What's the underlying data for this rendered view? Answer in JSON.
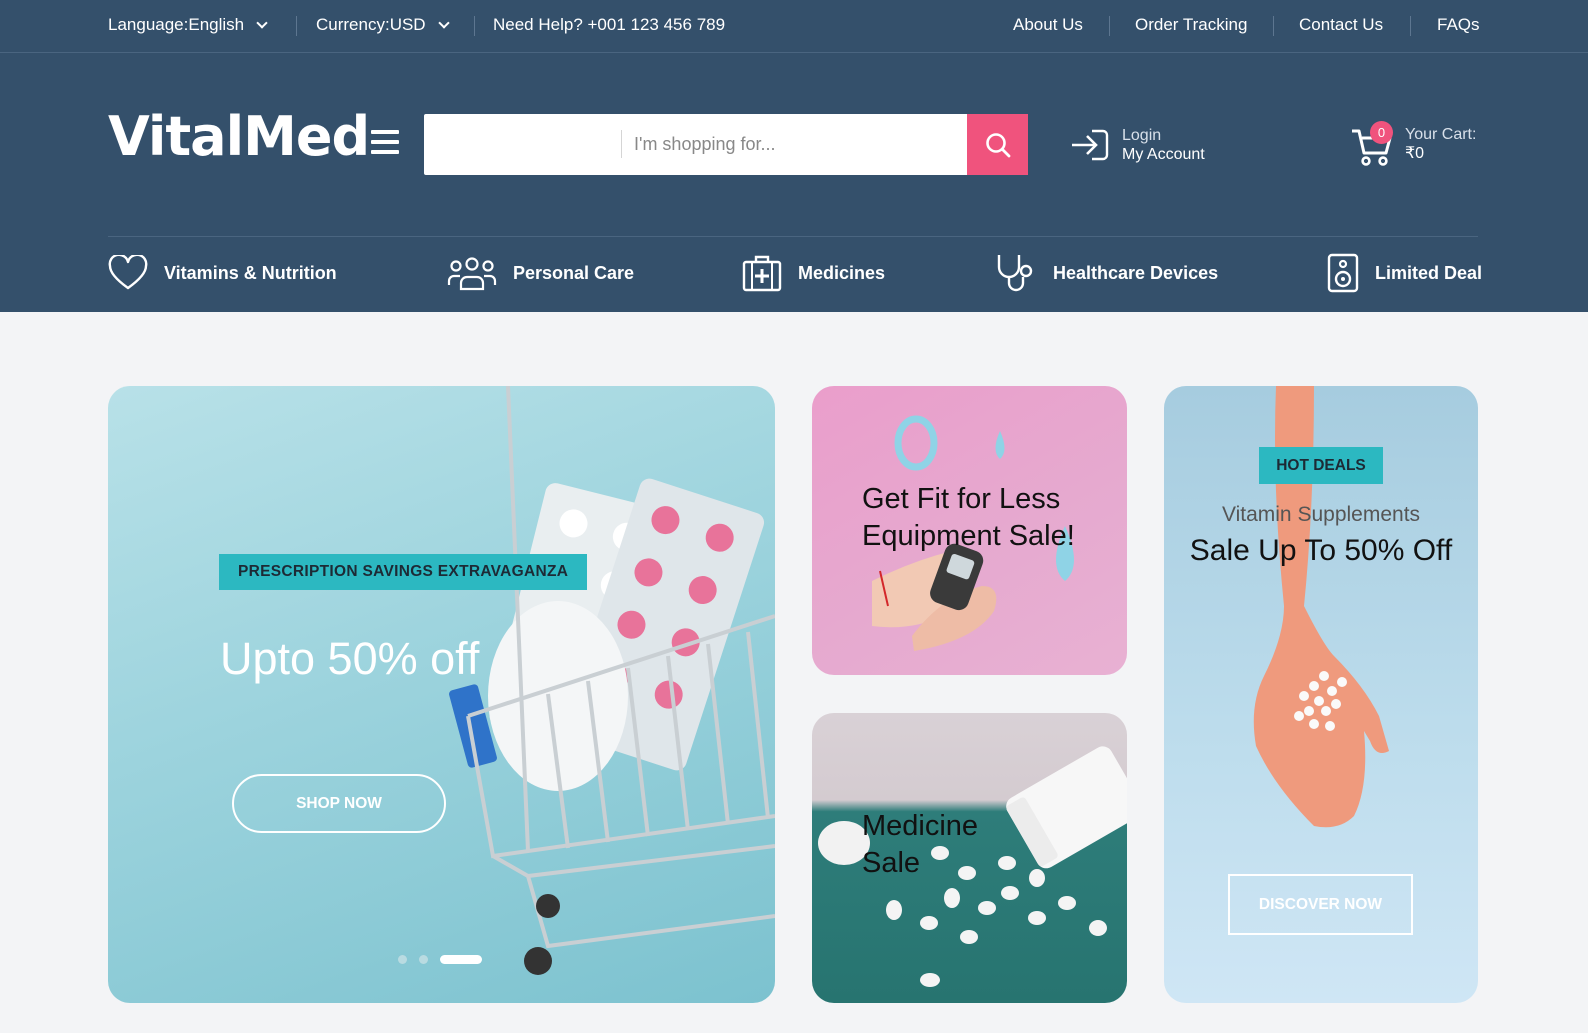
{
  "topbar": {
    "language_label": "Language:",
    "language_value": "English",
    "currency_label": "Currency:",
    "currency_value": "USD",
    "help_text": "Need Help? +001 123 456 789",
    "links": [
      "About Us",
      "Order Tracking",
      "Contact Us",
      "FAQs"
    ]
  },
  "header": {
    "logo": "VitalMed",
    "search_placeholder": "I'm shopping for...",
    "login_line1": "Login",
    "login_line2": "My Account",
    "cart_count": "0",
    "cart_label": "Your Cart:",
    "cart_total": "₹0"
  },
  "categories": [
    {
      "label": "Vitamins & Nutrition",
      "icon": "heart-icon"
    },
    {
      "label": "Personal Care",
      "icon": "users-icon"
    },
    {
      "label": "Medicines",
      "icon": "medical-kit-icon"
    },
    {
      "label": "Healthcare Devices",
      "icon": "stethoscope-icon"
    },
    {
      "label": "Limited Deal",
      "icon": "speaker-icon"
    }
  ],
  "hero": {
    "tag": "PRESCRIPTION SAVINGS EXTRAVAGANZA",
    "headline": "Upto 50% off",
    "button": "SHOP NOW",
    "slide_count": 3,
    "active_slide": 3
  },
  "card_fit": {
    "title_line1": "Get Fit for Less",
    "title_line2": "Equipment Sale!"
  },
  "card_med": {
    "title_line1": "Medicine",
    "title_line2": "Sale"
  },
  "card_vit": {
    "tag": "HOT DEALS",
    "subtitle": "Vitamin Supplements",
    "title": "Sale Up To 50% Off",
    "button": "DISCOVER NOW"
  },
  "colors": {
    "header_bg": "#34506b",
    "accent_pink": "#f0537d",
    "accent_teal": "#2cb8c1"
  }
}
